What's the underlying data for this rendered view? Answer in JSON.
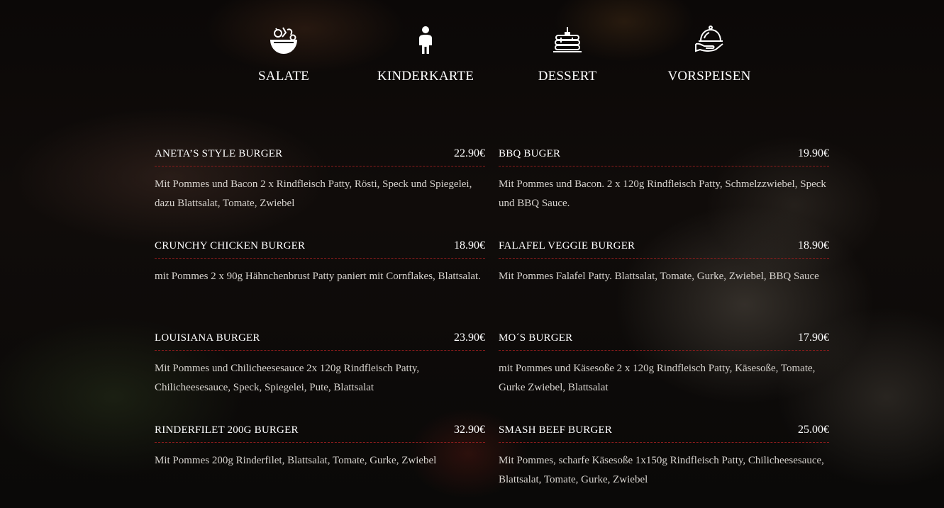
{
  "categories": [
    {
      "label": "SALATE",
      "icon": "salad-bowl-icon"
    },
    {
      "label": "KINDERKARTE",
      "icon": "child-icon"
    },
    {
      "label": "DESSERT",
      "icon": "pancakes-icon"
    },
    {
      "label": "VORSPEISEN",
      "icon": "serving-cloche-icon"
    }
  ],
  "items": [
    {
      "name": "ANETA’S STYLE BURGER",
      "price": "22.90€",
      "desc": "Mit Pommes und Bacon 2 x Rindfleisch Patty, Rösti, Speck und Spiegelei, dazu Blattsalat, Tomate, Zwiebel"
    },
    {
      "name": "BBQ BUGER",
      "price": "19.90€",
      "desc": "Mit Pommes und Bacon. 2 x 120g Rindfleisch Patty, Schmelzzwiebel, Speck und BBQ Sauce."
    },
    {
      "name": "CRUNCHY CHICKEN BURGER",
      "price": "18.90€",
      "desc": "mit Pommes 2 x 90g Hähnchenbrust Patty paniert mit Cornflakes, Blattsalat."
    },
    {
      "name": "FALAFEL VEGGIE BURGER",
      "price": "18.90€",
      "desc": "Mit Pommes Falafel Patty. Blattsalat, Tomate, Gurke, Zwiebel, BBQ Sauce"
    },
    {
      "name": "LOUISIANA BURGER",
      "price": "23.90€",
      "desc": "Mit Pommes und Chilicheesesauce 2x 120g Rindfleisch Patty, Chilicheesesauce, Speck, Spiegelei, Pute, Blattsalat"
    },
    {
      "name": "MO´S BURGER",
      "price": "17.90€",
      "desc": "mit Pommes und Käsesoße 2 x 120g Rindfleisch Patty, Käsesoße, Tomate, Gurke Zwiebel, Blattsalat"
    },
    {
      "name": "RINDERFILET 200G BURGER",
      "price": "32.90€",
      "desc": "Mit Pommes 200g Rinderfilet, Blattsalat, Tomate, Gurke, Zwiebel"
    },
    {
      "name": "SMASH BEEF BURGER",
      "price": "25.00€",
      "desc": "Mit Pommes, scharfe Käsesoße 1x150g Rindfleisch Patty, Chilicheesesauce, Blattsalat, Tomate, Gurke, Zwiebel"
    }
  ],
  "colors": {
    "divider": "#8b1c1c",
    "text": "#ffffff",
    "description": "#d8d4cf"
  }
}
